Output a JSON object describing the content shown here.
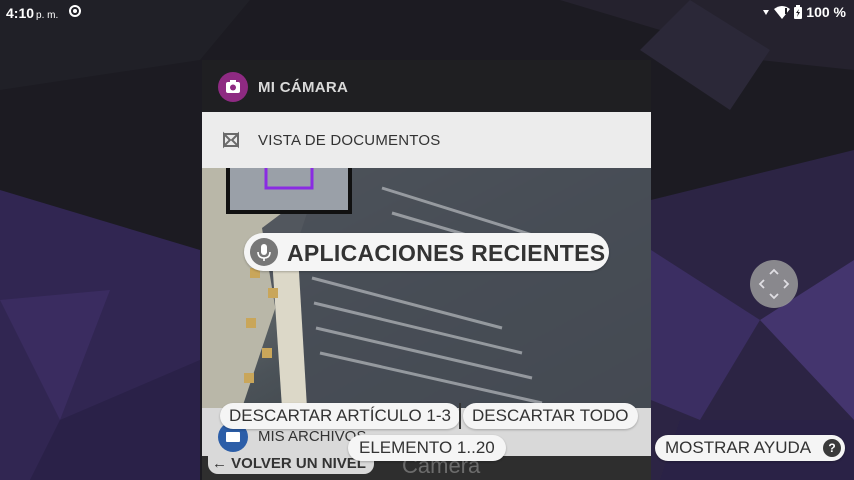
{
  "status_bar": {
    "time": "4:10",
    "ampm": "p. m.",
    "battery": "100 %"
  },
  "recents": {
    "card_camera": {
      "label": "MI CÁMARA"
    },
    "card_documents": {
      "label": "VISTA DE DOCUMENTOS"
    },
    "card_files": {
      "label": "MIS ARCHIVOS",
      "back_label": "VOLVER UN NIVEL",
      "folder_title": "Camera"
    }
  },
  "voice_overlay": {
    "heading": "APLICACIONES RECIENTES",
    "dismiss_item": "DESCARTAR ARTÍCULO 1-3",
    "dismiss_all": "DESCARTAR TODO",
    "element_range": "ELEMENTO 1..20",
    "show_help": "MOSTRAR AYUDA",
    "help_glyph": "?"
  },
  "icons": {
    "camera": "camera-icon",
    "documents": "document-view-icon",
    "folder": "folder-icon",
    "mic": "microphone-icon",
    "help": "help-icon",
    "nav": "directional-pad-icon",
    "wifi": "wifi-icon",
    "battery": "battery-icon",
    "sync": "sync-icon"
  },
  "colors": {
    "camera_accent": "#8e2a82",
    "files_accent": "#2c5ea8",
    "wallpaper_base": "#1b1a22",
    "wallpaper_purple": "#3a2c5a"
  }
}
